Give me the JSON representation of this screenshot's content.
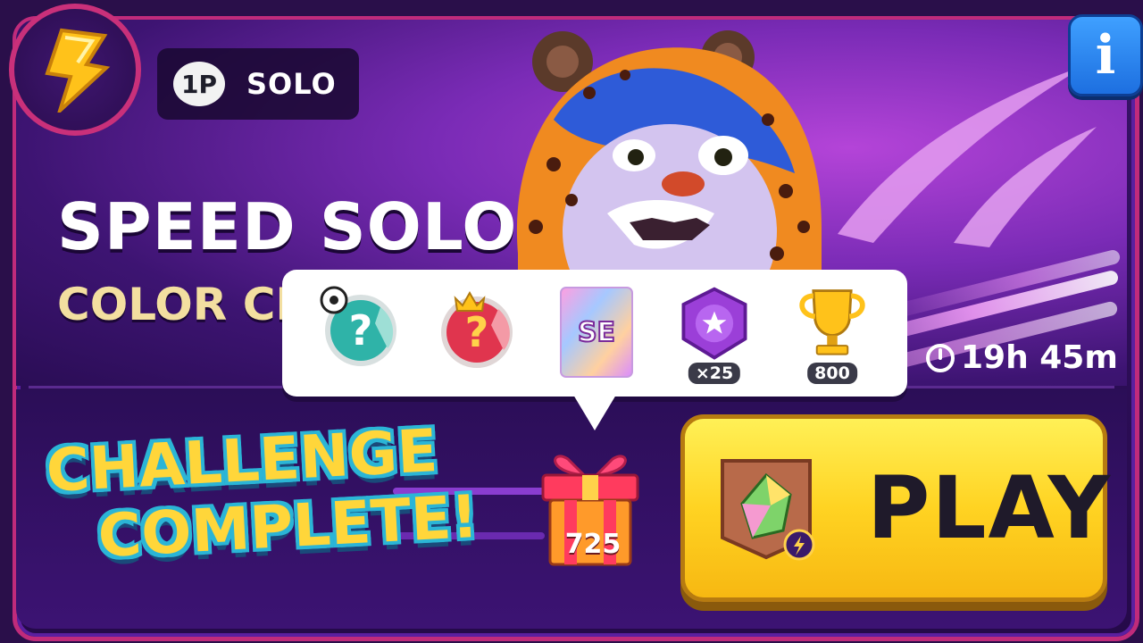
{
  "colors": {
    "frame_border": "#c02b7b",
    "panel_bg": "#2b0d55",
    "title_text": "#ffffff",
    "subtitle_text": "#f3dfa0",
    "play_button": "#ffd322",
    "challenge_text": "#ffd63a",
    "challenge_outline": "#2bb5d6",
    "info_button": "#1d6fe0"
  },
  "header": {
    "badge_icon": "lightning-bolt-icon",
    "mode_badge": "1P",
    "mode_label": "SOLO",
    "info_icon": "info-icon"
  },
  "event": {
    "title": "SPEED SOLO",
    "subtitle": "COLOR CRYS",
    "timer": "19h 45m"
  },
  "rewards": [
    {
      "icon": "mystery-sticker-teal-icon",
      "count": ""
    },
    {
      "icon": "mystery-sticker-red-crown-icon",
      "count": ""
    },
    {
      "icon": "special-edition-card-icon",
      "label": "SE",
      "count": ""
    },
    {
      "icon": "purple-medal-icon",
      "count": "×25"
    },
    {
      "icon": "gold-trophy-icon",
      "count": "800"
    }
  ],
  "gift": {
    "icon": "gift-box-icon",
    "count": "725"
  },
  "banner": {
    "line1": "CHALLENGE",
    "line2": "COMPLETE!"
  },
  "play_button": {
    "icon": "color-crystal-icon",
    "label": "PLAY"
  }
}
